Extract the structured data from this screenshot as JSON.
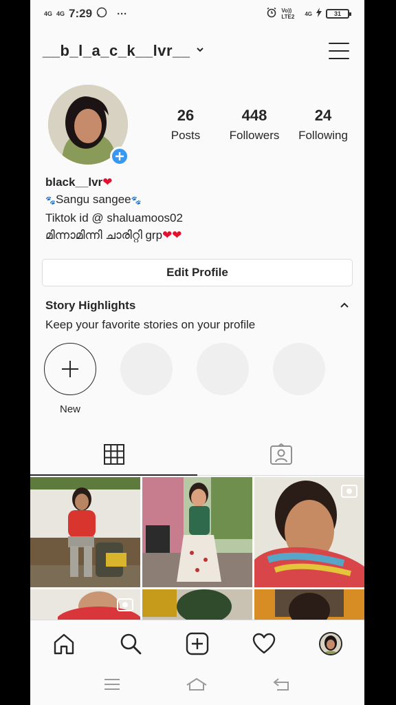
{
  "status_bar": {
    "network1": "4G",
    "network2": "4G",
    "time": "7:29",
    "dots": "···",
    "lte": "Vo)) LTE2",
    "lte2": "4G",
    "battery": "31"
  },
  "header": {
    "username": "__b_l_a_c_k__lvr__"
  },
  "stats": [
    {
      "value": "26",
      "label": "Posts"
    },
    {
      "value": "448",
      "label": "Followers"
    },
    {
      "value": "24",
      "label": "Following"
    }
  ],
  "bio": {
    "name": "black__lvr",
    "line1": "Sangu sangee",
    "line2": "Tiktok id  @ shaluamoos02",
    "line3": "മിന്നാമിന്നി ചാരിറ്റി grp"
  },
  "edit_profile": "Edit Profile",
  "highlights": {
    "title": "Story Highlights",
    "subtitle": "Keep your favorite stories on your profile",
    "new_label": "New"
  },
  "colors": {
    "accent": "#3897f0",
    "heart": "#e3112d",
    "text": "#262626",
    "border": "#dbdbdb"
  },
  "icons": {
    "grid": "grid-icon",
    "tagged": "tagged-icon",
    "home": "home-icon",
    "search": "search-icon",
    "add": "add-post-icon",
    "activity": "heart-icon"
  }
}
